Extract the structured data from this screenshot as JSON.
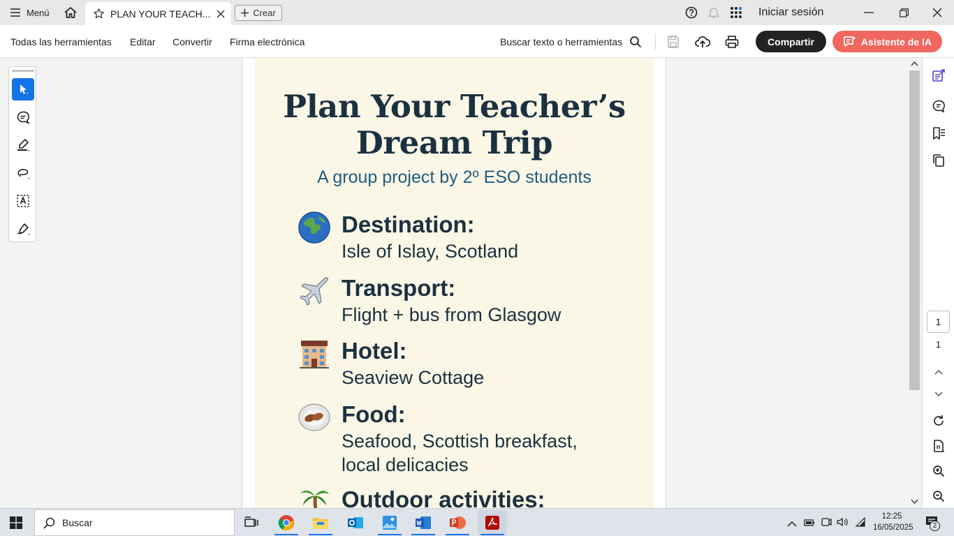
{
  "titlebar": {
    "menu_label": "Menú",
    "tab_title": "PLAN YOUR TEACH...",
    "create_label": "Crear",
    "signin_label": "Iniciar sesión"
  },
  "toolbar": {
    "items": [
      "Todas las herramientas",
      "Editar",
      "Convertir",
      "Firma electrónica"
    ],
    "search_label": "Buscar texto o herramientas",
    "share_label": "Compartir",
    "ai_label": "Asistente de IA"
  },
  "document": {
    "title_line1": "Plan Your Teacher’s",
    "title_line2": "Dream Trip",
    "subtitle": "A group project by 2º ESO students",
    "sections": [
      {
        "heading": "Destination:",
        "value": [
          "Isle of Islay, Scotland"
        ],
        "icon": "globe-icon"
      },
      {
        "heading": "Transport:",
        "value": [
          "Flight + bus from Glasgow"
        ],
        "icon": "airplane-icon"
      },
      {
        "heading": "Hotel:",
        "value": [
          "Seaview Cottage"
        ],
        "icon": "hotel-icon"
      },
      {
        "heading": "Food:",
        "value": [
          "Seafood, Scottish breakfast,",
          "local delicacies"
        ],
        "icon": "food-plate-icon"
      },
      {
        "heading": "Outdoor activities:",
        "value": [],
        "icon": "palm-tree-icon"
      }
    ]
  },
  "page_nav": {
    "current_page": "1",
    "total_pages": "1"
  },
  "taskbar": {
    "search_placeholder": "Buscar",
    "time": "12:25",
    "date": "16/05/2025",
    "notifications": "2"
  },
  "colors": {
    "accent": "#1473e6",
    "ai_button": "#f0675f",
    "poster_bg": "#fbf7e7",
    "poster_title": "#1c3140",
    "poster_subtitle": "#1f5d7e"
  }
}
